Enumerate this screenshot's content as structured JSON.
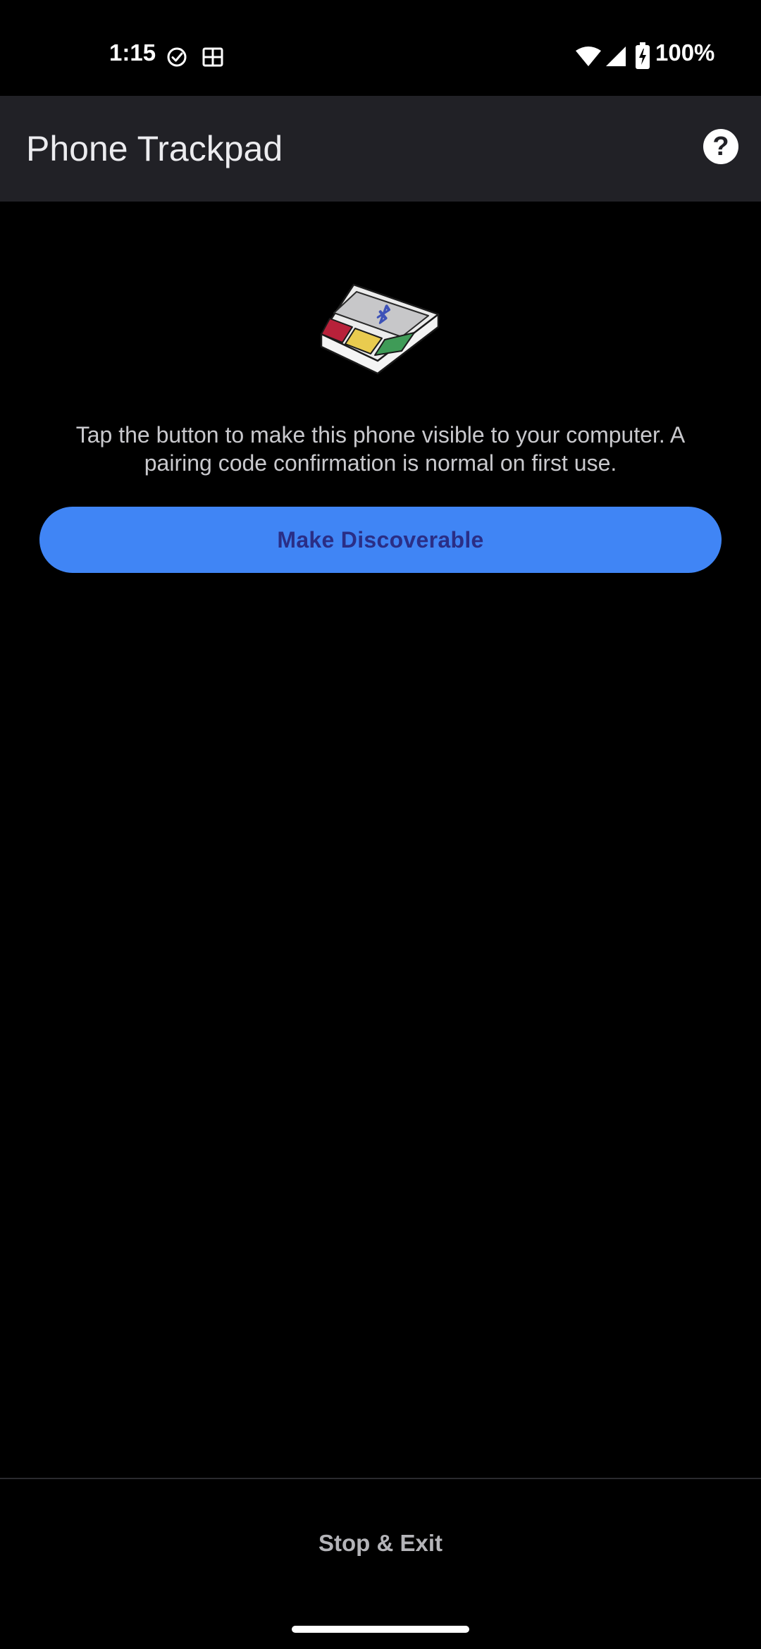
{
  "status_bar": {
    "time": "1:15",
    "battery_percent": "100%",
    "icons": {
      "left": [
        "check-circle-icon",
        "grid-icon"
      ],
      "right": [
        "wifi-icon",
        "cellular-signal-icon",
        "battery-charging-icon"
      ]
    }
  },
  "app_bar": {
    "title": "Phone Trackpad",
    "help_icon": "help-circle-icon"
  },
  "main": {
    "illustration": "bluetooth-trackpad-illustration",
    "instructions": "Tap the button to make this phone visible to your computer. A pairing code confirmation is normal on first use.",
    "primary_button_label": "Make Discoverable"
  },
  "footer": {
    "exit_label": "Stop & Exit"
  },
  "colors": {
    "background": "#000000",
    "app_bar": "#212126",
    "primary_button": "#4085f5",
    "primary_button_text": "#2a2e86",
    "trackpad_left_button": "#b8213a",
    "trackpad_middle_button": "#e9cb4f",
    "trackpad_right_button": "#3f9b57",
    "bluetooth_symbol": "#3d52b8"
  }
}
